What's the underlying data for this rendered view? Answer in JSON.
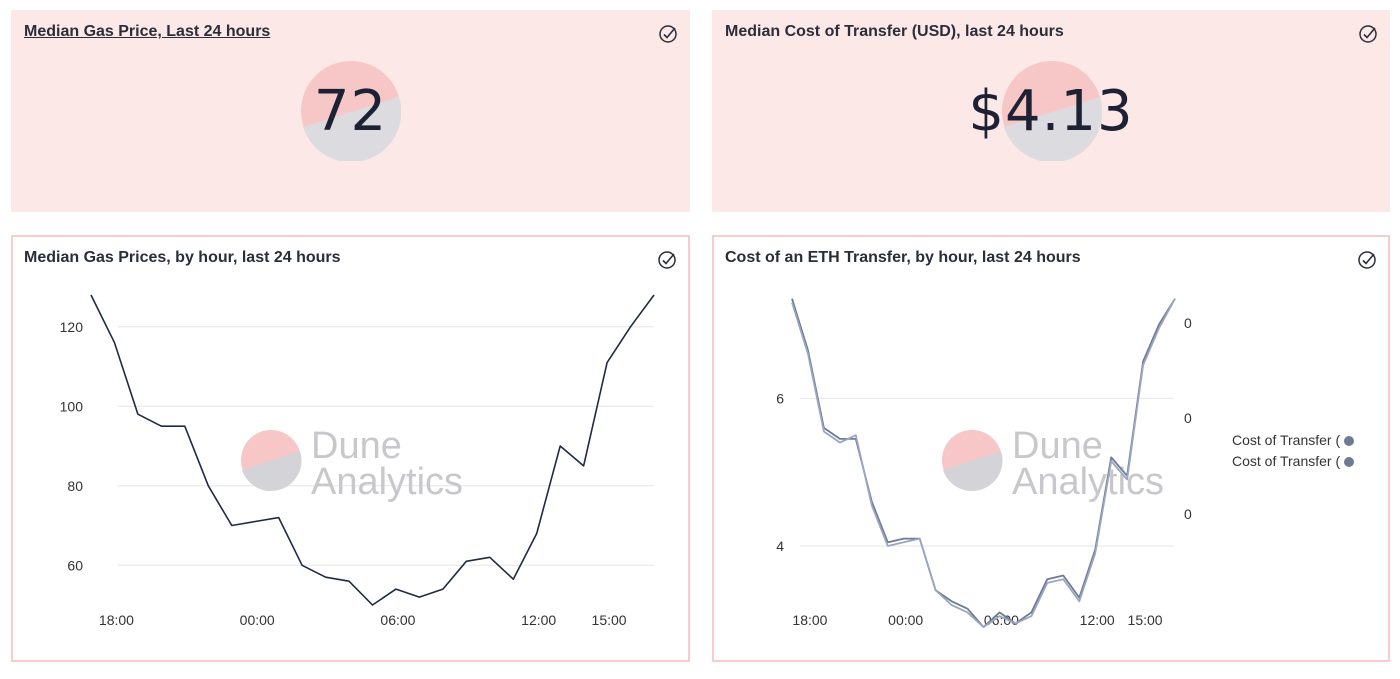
{
  "colors": {
    "panel_bg": "#fde8e8",
    "border": "#f6cccc",
    "line": "#1f2a44",
    "series1": "#6e7a93",
    "series2": "#9aa6c2",
    "watermark_pink": "#f7c6c6",
    "watermark_grey": "#d3d3d8"
  },
  "icons": [
    "check-circle-icon",
    "dune-logo-icon"
  ],
  "panels": {
    "gas_counter": {
      "title": "Median Gas Price, Last 24 hours",
      "value": "72"
    },
    "cost_counter": {
      "title": "Median Cost of Transfer (USD), last 24 hours",
      "value": "$4.13"
    },
    "gas_chart": {
      "title": "Median Gas Prices, by hour, last 24 hours"
    },
    "cost_chart": {
      "title": "Cost of an ETH Transfer, by hour, last 24 hours"
    }
  },
  "watermark": {
    "line1": "Dune",
    "line2": "Analytics"
  },
  "chart_data": [
    {
      "type": "line",
      "title": "Median Gas Prices, by hour, last 24 hours",
      "x_ticks": [
        "18:00",
        "00:00",
        "06:00",
        "12:00",
        "15:00"
      ],
      "y_ticks": [
        60,
        80,
        100,
        120
      ],
      "ylim": [
        50,
        128
      ],
      "grid": true,
      "x": [
        "17:00",
        "18:00",
        "19:00",
        "20:00",
        "21:00",
        "22:00",
        "23:00",
        "00:00",
        "01:00",
        "02:00",
        "03:00",
        "04:00",
        "05:00",
        "06:00",
        "07:00",
        "08:00",
        "09:00",
        "10:00",
        "11:00",
        "12:00",
        "13:00",
        "14:00",
        "15:00",
        "16:00",
        "17:00"
      ],
      "series": [
        {
          "values": [
            128,
            116,
            98,
            95,
            95,
            80,
            70,
            71,
            72,
            60,
            57,
            56,
            50,
            54,
            52,
            54,
            61,
            62,
            56.5,
            68,
            90,
            85,
            111,
            120,
            128
          ]
        }
      ]
    },
    {
      "type": "line",
      "title": "Cost of an ETH Transfer, by hour, last 24 hours",
      "x_ticks": [
        "18:00",
        "00:00",
        "06:00",
        "12:00",
        "15:00"
      ],
      "y_ticks_left": [
        4,
        6
      ],
      "y_ticks_right": [
        "0",
        "0",
        "0"
      ],
      "ylim": [
        3.2,
        7.4
      ],
      "grid": true,
      "legend_position": "right",
      "series": [
        {
          "name": "Cost of Transfer (U",
          "values": [
            7.35,
            6.65,
            5.6,
            5.45,
            5.45,
            4.6,
            4.05,
            4.1,
            4.1,
            3.4,
            3.25,
            3.15,
            2.9,
            3.1,
            2.95,
            3.1,
            3.55,
            3.6,
            3.3,
            3.95,
            5.2,
            4.95,
            6.5,
            7.0,
            7.35
          ]
        },
        {
          "name": "Cost of Transfer (E",
          "values": [
            7.3,
            6.6,
            5.55,
            5.4,
            5.5,
            4.55,
            4.0,
            4.05,
            4.1,
            3.4,
            3.2,
            3.1,
            2.9,
            3.05,
            2.95,
            3.05,
            3.5,
            3.55,
            3.25,
            3.9,
            5.15,
            4.9,
            6.45,
            6.95,
            7.35
          ]
        }
      ]
    }
  ]
}
